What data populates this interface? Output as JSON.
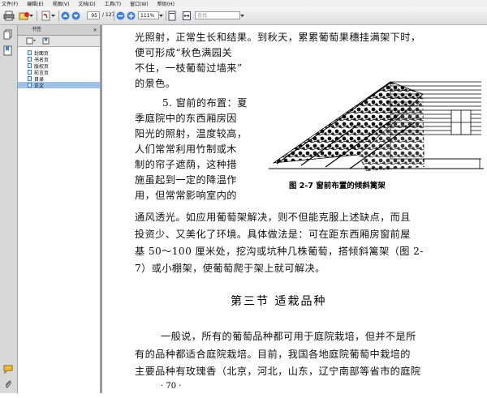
{
  "menu": [
    "文件(F)",
    "编辑(E)",
    "视图(V)",
    "文档(D)",
    "工具(T)",
    "窗口(W)",
    "帮助(H)"
  ],
  "toolbar": {
    "page_current": "95",
    "page_total": "/ 127",
    "zoom": "111%",
    "search_placeholder": "查找"
  },
  "bookmarks": {
    "title": "书签",
    "items": [
      {
        "label": "封面页",
        "selected": false
      },
      {
        "label": "书名页",
        "selected": false
      },
      {
        "label": "版权页",
        "selected": false
      },
      {
        "label": "前言页",
        "selected": false
      },
      {
        "label": "目录",
        "selected": false
      },
      {
        "label": "正文",
        "selected": true
      }
    ]
  },
  "page": {
    "lines_top": [
      "光照射，正常生长和结果。到秋天，累累葡萄果穗挂满架下时，",
      "便可形成“秋色满园关",
      "不住，一枝葡萄过墙来”",
      "的景色。",
      "5. 窗前的布置：夏",
      "季庭院中的东西厢房因",
      "阳光的照射，温度较高，",
      "人们常常利用竹制或木",
      "制的帘子遮荫，这种措",
      "施虽起到一定的降温作",
      "用，但常常影响室内的",
      "通风透光。如应用葡萄架解决，则不但能克服上述缺点，而且",
      "投资少、又美化了环境。具体做法是：可在距东西厢房窗前屋",
      "基 50～100 厘米处，挖沟或坑种几株葡萄，搭倾斜篱架（图 2-",
      "7）或小棚架，使葡萄爬于架上就可解决。"
    ],
    "figure_caption": "图 2-7   窗前布置的倾斜篱架",
    "section_heading": "第三节    适栽品种",
    "lines_bottom": [
      "一般说，所有的葡萄品种都可用于庭院栽培，但并不是所",
      "有的品种都适合庭院栽培。目前，我国各地庭院葡萄中栽培的",
      "主要品种有玫瑰香（北京，河北，山东，辽宁南部等省市的庭院"
    ],
    "page_number": "· 70 ·"
  }
}
